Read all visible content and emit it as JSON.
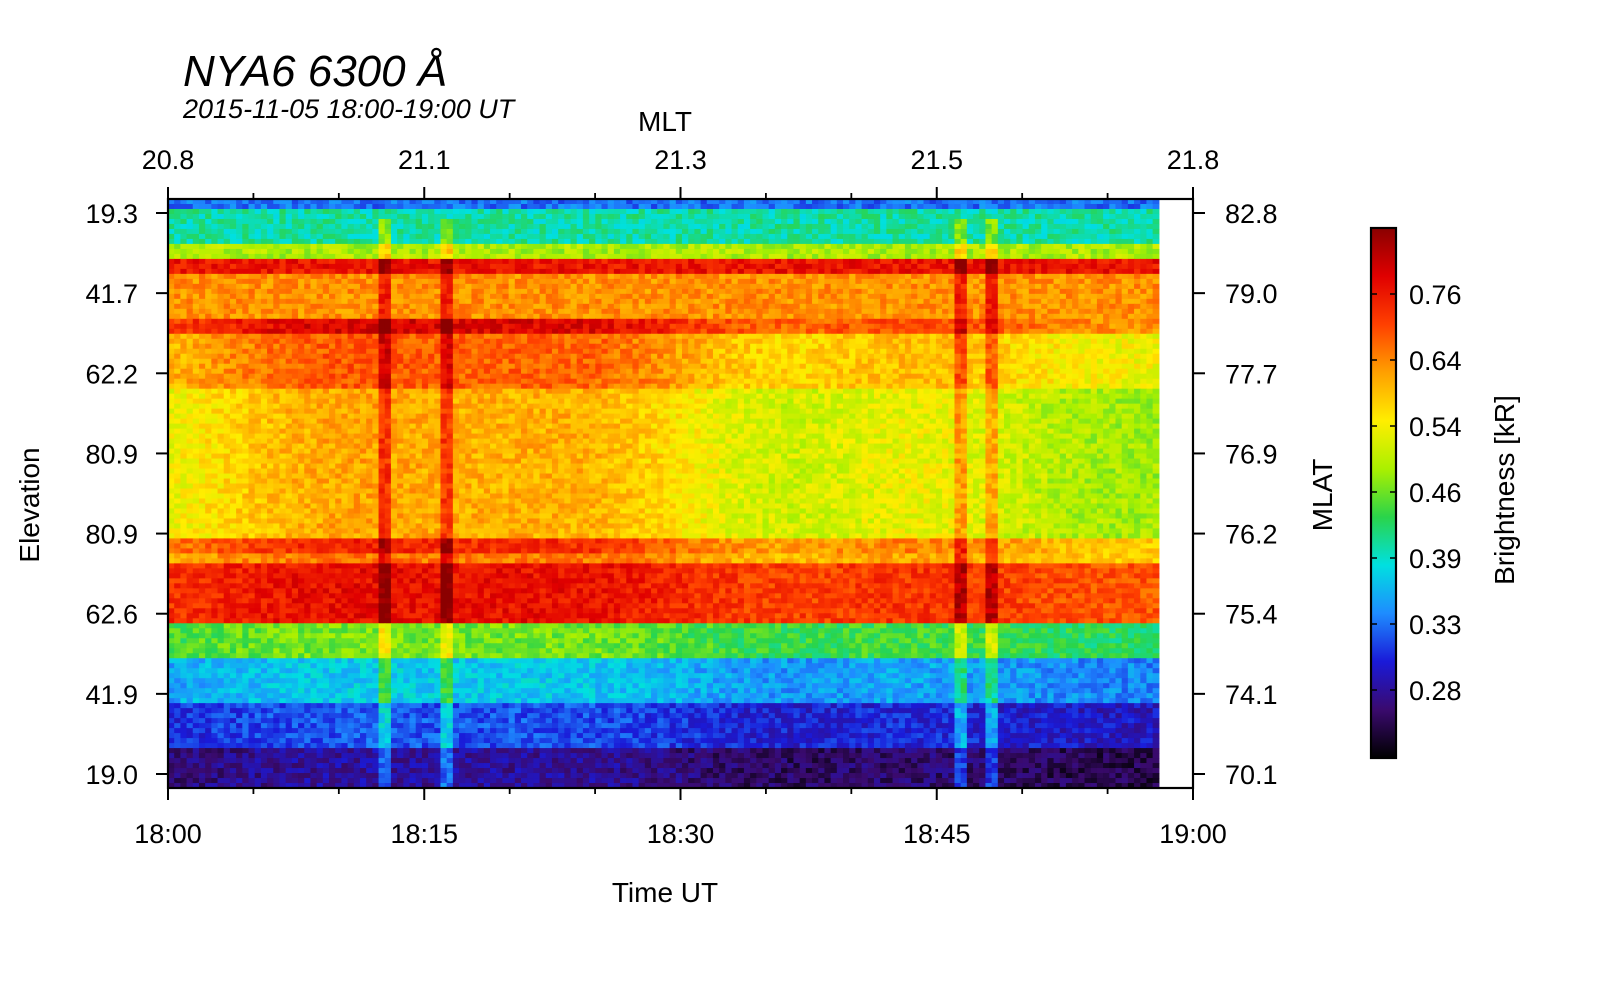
{
  "chart_data": {
    "type": "heatmap",
    "title": "NYA6 6300 Å",
    "subtitle": "2015-11-05 18:00-19:00 UT",
    "xlabel": "Time UT",
    "x_top_label": "MLT",
    "ylabel": "Elevation",
    "y_right_label": "MLAT",
    "colorbar_label": "Brightness [kR]",
    "x_ticks": [
      "18:00",
      "18:15",
      "18:30",
      "18:45",
      "19:00"
    ],
    "x_top_ticks": [
      "20.8",
      "21.1",
      "21.3",
      "21.5",
      "21.8"
    ],
    "y_left_ticks": [
      "19.3",
      "41.7",
      "62.2",
      "80.9",
      "80.9",
      "62.6",
      "41.9",
      "19.0"
    ],
    "y_right_ticks": [
      "82.8",
      "79.0",
      "77.7",
      "76.9",
      "76.2",
      "75.4",
      "74.1",
      "70.1"
    ],
    "colorbar_ticks": [
      "0.76",
      "0.64",
      "0.54",
      "0.46",
      "0.39",
      "0.33",
      "0.28"
    ],
    "xlim": [
      "18:00",
      "19:00"
    ],
    "data_end": "18:58",
    "colormap": [
      "#000000",
      "#3a0a6e",
      "#1a1ad8",
      "#1e8cff",
      "#00e0e0",
      "#2ad44a",
      "#aaf000",
      "#ffee00",
      "#ffa000",
      "#ff4000",
      "#e00000",
      "#8a0000"
    ],
    "brightness_bands": [
      {
        "elev_range": [
          "19.3",
          "41.7"
        ],
        "level": "0.33–0.46"
      },
      {
        "elev_range": [
          "41.7",
          "41.7"
        ],
        "level": "0.76"
      },
      {
        "elev_range": [
          "41.7",
          "62.2"
        ],
        "level": "0.54–0.64"
      },
      {
        "elev_range": [
          "62.2",
          "80.9"
        ],
        "level": "0.39–0.54"
      },
      {
        "elev_range": [
          "80.9",
          "62.6"
        ],
        "level": "0.64–0.76"
      },
      {
        "elev_range": [
          "62.6",
          "41.9"
        ],
        "level": "0.33–0.46"
      },
      {
        "elev_range": [
          "41.9",
          "19.0"
        ],
        "level": "0.28"
      }
    ]
  }
}
